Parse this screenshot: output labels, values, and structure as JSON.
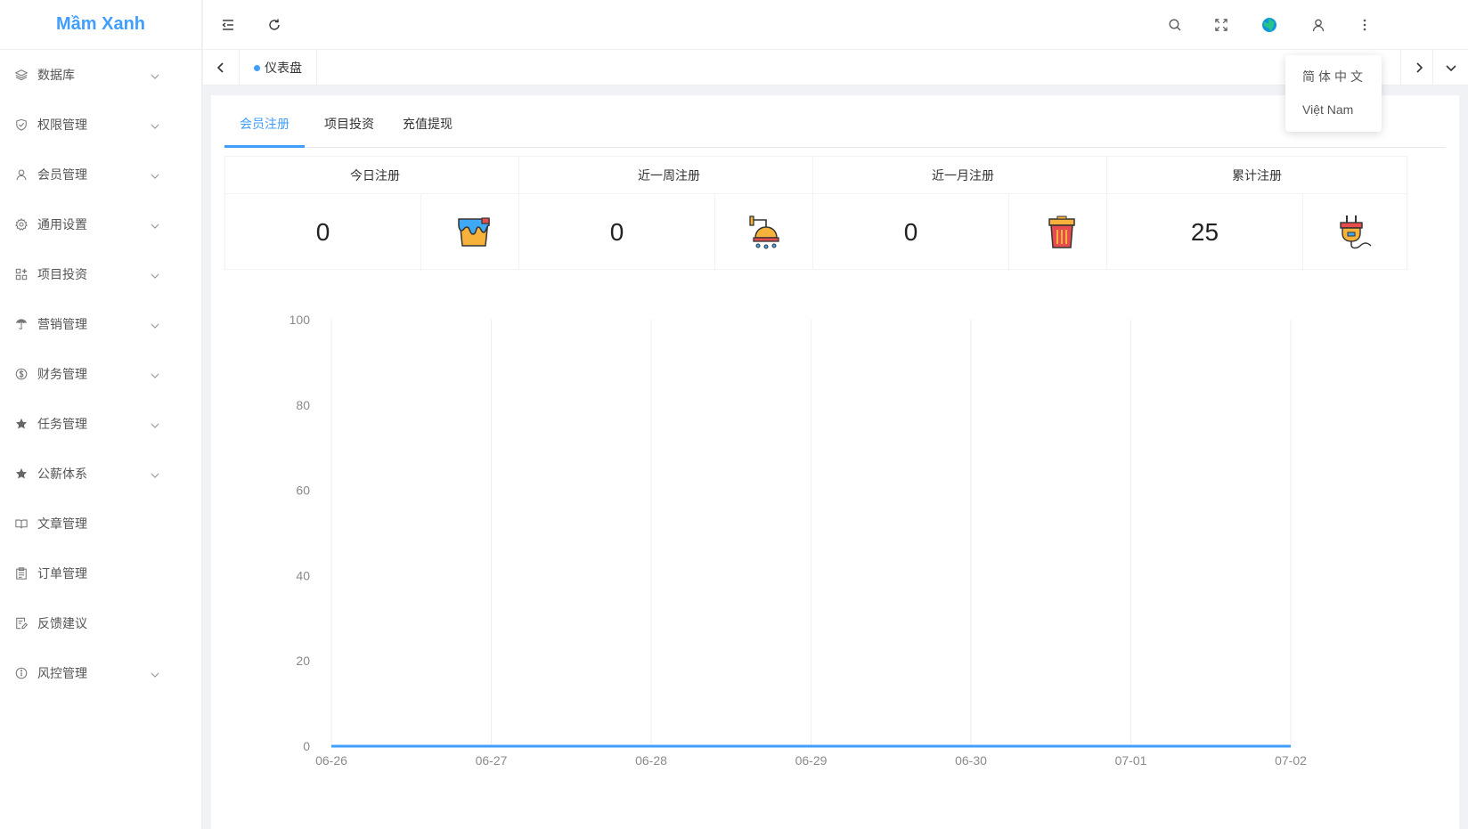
{
  "app": {
    "logo_text": "Mầm Xanh"
  },
  "sidebar": {
    "items": [
      {
        "label": "数据库",
        "icon": "layers-icon",
        "has_children": true
      },
      {
        "label": "权限管理",
        "icon": "shield-check-icon",
        "has_children": true
      },
      {
        "label": "会员管理",
        "icon": "user-icon",
        "has_children": true
      },
      {
        "label": "通用设置",
        "icon": "gear-icon",
        "has_children": true
      },
      {
        "label": "项目投资",
        "icon": "apps-add-icon",
        "has_children": true
      },
      {
        "label": "营销管理",
        "icon": "umbrella-icon",
        "has_children": true
      },
      {
        "label": "财务管理",
        "icon": "dollar-circle-icon",
        "has_children": true
      },
      {
        "label": "任务管理",
        "icon": "star-icon",
        "has_children": true
      },
      {
        "label": "公薪体系",
        "icon": "star-icon",
        "has_children": true
      },
      {
        "label": "文章管理",
        "icon": "open-book-icon",
        "has_children": false
      },
      {
        "label": "订单管理",
        "icon": "clipboard-icon",
        "has_children": false
      },
      {
        "label": "反馈建议",
        "icon": "edit-document-icon",
        "has_children": false
      },
      {
        "label": "风控管理",
        "icon": "info-circle-icon",
        "has_children": true
      }
    ]
  },
  "header": {
    "left_icons": [
      "menu-fold-icon",
      "refresh-icon"
    ],
    "right_icons": [
      "search-icon",
      "fullscreen-icon",
      "globe-icon",
      "user-icon",
      "more-vertical-icon"
    ]
  },
  "tabsbar": {
    "active_tab": "仪表盘"
  },
  "language_menu": {
    "options": [
      "简体中文",
      "Việt Nam"
    ]
  },
  "content": {
    "tabs": [
      "会员注册",
      "项目投资",
      "充值提现"
    ],
    "active_tab_index": 0,
    "stats": [
      {
        "title": "今日注册",
        "value": "0",
        "icon": "paint-bucket-icon"
      },
      {
        "title": "近一周注册",
        "value": "0",
        "icon": "shower-icon"
      },
      {
        "title": "近一月注册",
        "value": "0",
        "icon": "trash-bin-icon"
      },
      {
        "title": "累计注册",
        "value": "25",
        "icon": "plug-icon"
      }
    ]
  },
  "colors": {
    "accent": "#409eff",
    "line": "#409eff"
  },
  "chart_data": {
    "type": "line",
    "title": "",
    "xlabel": "",
    "ylabel": "",
    "categories": [
      "06-26",
      "06-27",
      "06-28",
      "06-29",
      "06-30",
      "07-01",
      "07-02"
    ],
    "values": [
      0,
      0,
      0,
      0,
      0,
      0,
      0
    ],
    "ylim": [
      0,
      100
    ],
    "yticks": [
      0,
      20,
      40,
      60,
      80,
      100
    ],
    "grid": "vertical"
  }
}
